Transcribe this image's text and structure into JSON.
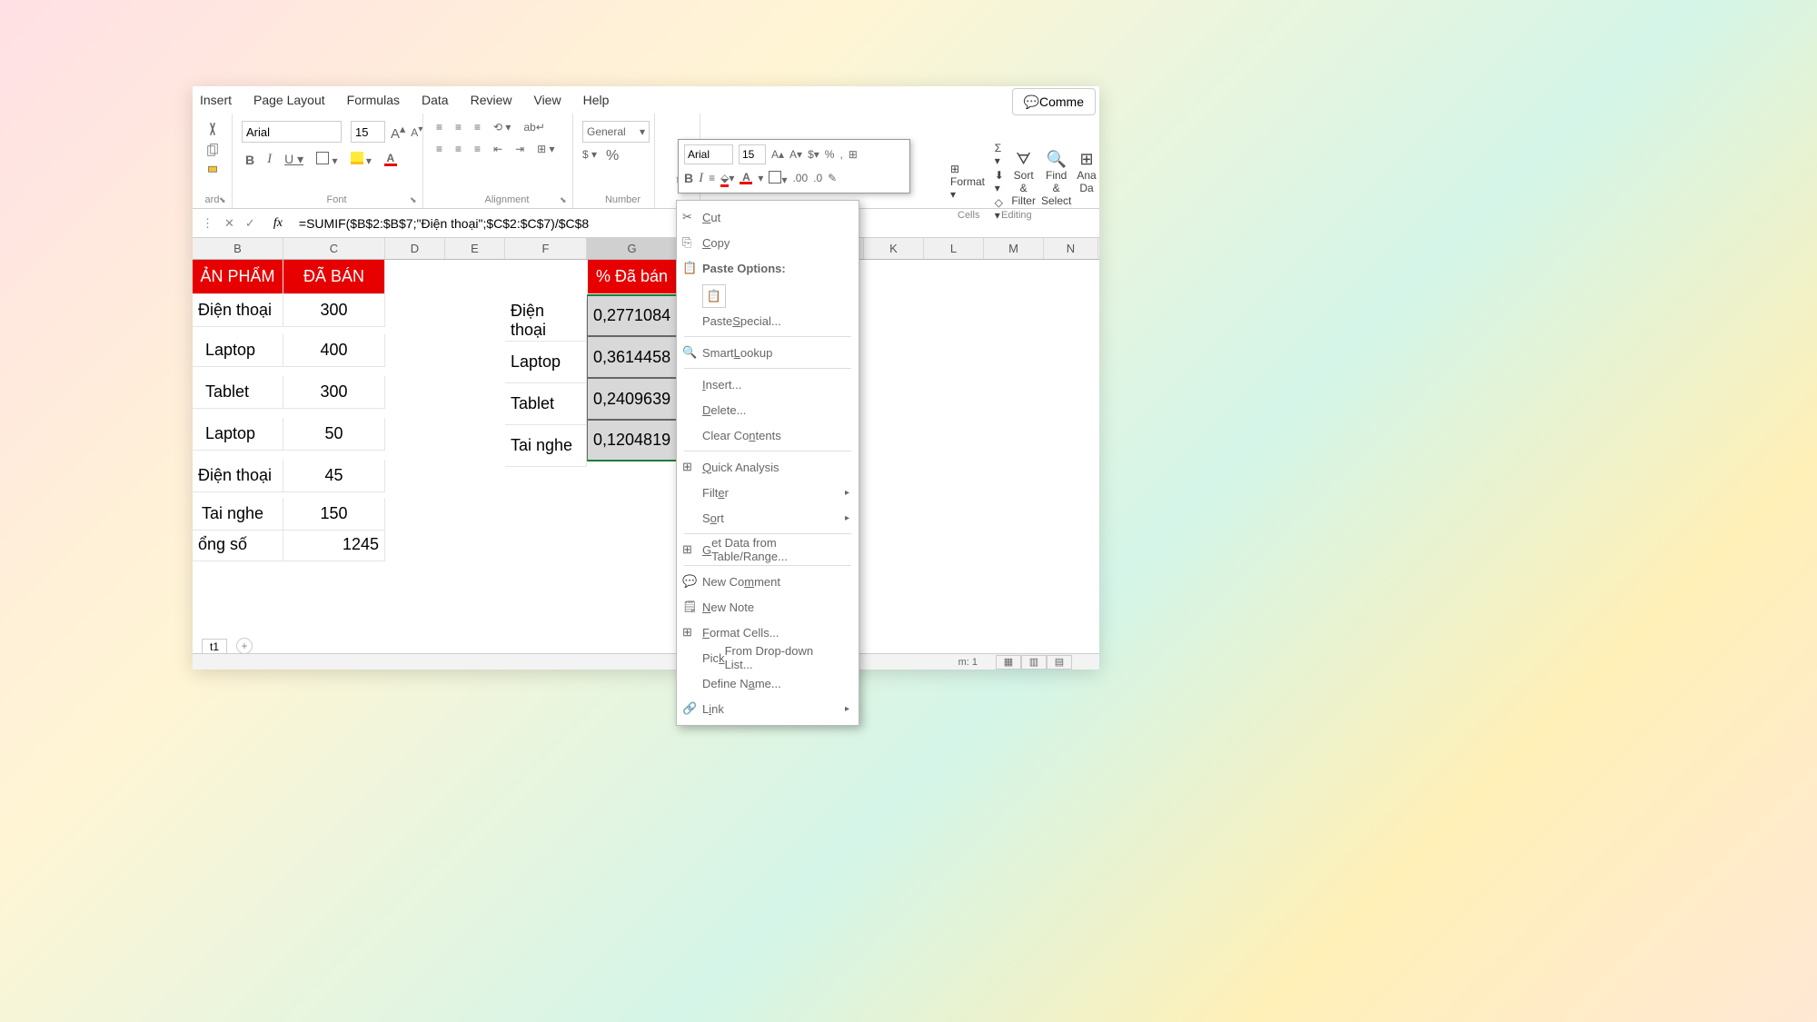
{
  "ribbon": {
    "tabs": [
      "Insert",
      "Page Layout",
      "Formulas",
      "Data",
      "Review",
      "View",
      "Help"
    ],
    "comments": "Comme"
  },
  "groups": {
    "clipboard": "ard",
    "font": "Font",
    "alignment": "Alignment",
    "number": "Number",
    "cells": "Cells",
    "editing": "Editing",
    "analyze": "Anal"
  },
  "font": {
    "name": "Arial",
    "size": "15"
  },
  "number": {
    "format": "General"
  },
  "formulabar": {
    "value": "=SUMIF($B$2:$B$7;\"Điện thoại\";$C$2:$C$7)/$C$8"
  },
  "cols": [
    "B",
    "C",
    "D",
    "E",
    "F",
    "G",
    "K",
    "L",
    "M",
    "N"
  ],
  "headers": {
    "b": "ẢN PHẨM",
    "c": "ĐÃ BÁN",
    "g": "% Đã bán"
  },
  "data": {
    "b": [
      "Điện thoại",
      "Laptop",
      "Tablet",
      "Laptop",
      "Điện thoại",
      "Tai nghe",
      "ổng số"
    ],
    "c": [
      "300",
      "400",
      "300",
      "50",
      "45",
      "150",
      "1245"
    ],
    "f": [
      "Điện thoại",
      "Laptop",
      "Tablet",
      "Tai nghe"
    ],
    "g": [
      "0,2771084",
      "0,3614458",
      "0,2409639",
      "0,1204819"
    ]
  },
  "mini": {
    "font": "Arial",
    "size": "15"
  },
  "context": {
    "cut": "Cut",
    "copy": "Copy",
    "paste_options": "Paste Options:",
    "paste_special": "Paste Special...",
    "smart_lookup": "Smart Lookup",
    "insert": "Insert...",
    "delete": "Delete...",
    "clear": "Clear Contents",
    "quick": "Quick Analysis",
    "filter": "Filter",
    "sort": "Sort",
    "get_data": "Get Data from Table/Range...",
    "comment": "New Comment",
    "note": "New Note",
    "format_cells": "Format Cells...",
    "pick": "Pick From Drop-down List...",
    "name": "Define Name...",
    "link": "Link"
  },
  "rpanel": {
    "format": "Format",
    "sort": "Sort &",
    "filter": "Filter",
    "find": "Find &",
    "select": "Select",
    "ana": "Ana",
    "da": "Da"
  },
  "sheet": "t1",
  "status": {
    "m": "m: 1"
  }
}
